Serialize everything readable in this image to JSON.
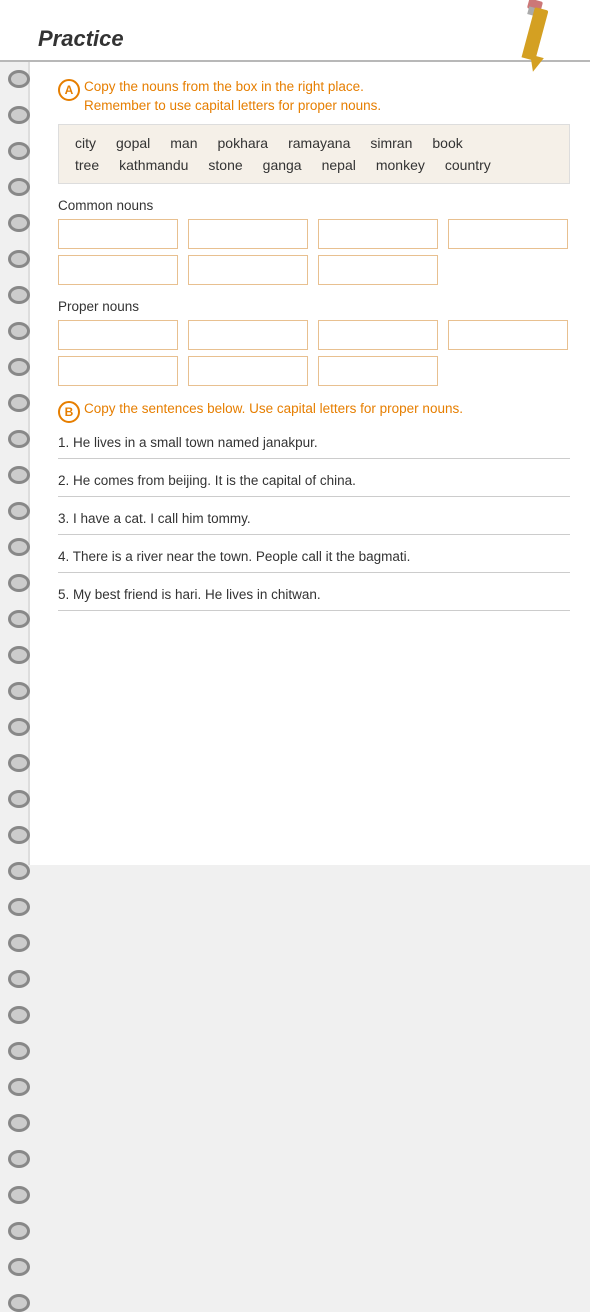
{
  "header": {
    "title": "Practice"
  },
  "pencil": {
    "alt": "pencil icon"
  },
  "sectionA": {
    "circle": "A",
    "instruction_line1": "Copy the nouns from the box in the right place.",
    "instruction_line2": "Remember to use capital letters for proper nouns.",
    "words_row1": [
      "city",
      "gopal",
      "man",
      "pokhara",
      "ramayana",
      "simran",
      "book"
    ],
    "words_row2": [
      "tree",
      "kathmandu",
      "stone",
      "ganga",
      "nepal",
      "monkey",
      "country"
    ],
    "common_nouns_label": "Common nouns",
    "proper_nouns_label": "Proper nouns"
  },
  "sectionB": {
    "circle": "B",
    "instruction": "Copy the sentences below. Use capital letters for proper nouns.",
    "sentences": [
      "1. He lives in a small town named janakpur.",
      "2. He comes from beijing. It is the capital of china.",
      "3. I have a cat. I call him tommy.",
      "4. There is a river near the town. People call it the bagmati.",
      "5. My best friend is hari. He lives in chitwan."
    ]
  }
}
